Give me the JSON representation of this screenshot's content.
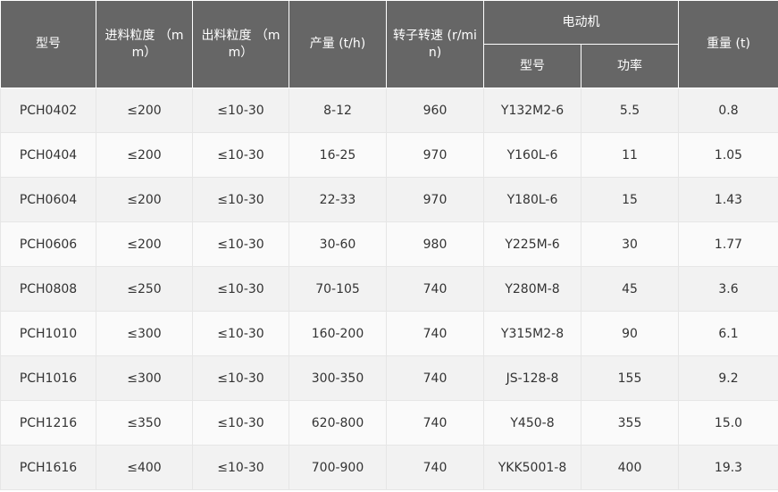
{
  "headers": {
    "model": "型号",
    "feed_size": "进料粒度 （mm）",
    "discharge_size": "出料粒度 （mm）",
    "capacity": "产量 (t/h)",
    "rotor_speed": "转子转速 (r/min)",
    "motor": "电动机",
    "motor_model": "型号",
    "motor_power": "功率",
    "weight": "重量 (t)"
  },
  "rows": [
    [
      "PCH0402",
      "≤200",
      "≤10-30",
      "8-12",
      "960",
      "Y132M2-6",
      "5.5",
      "0.8"
    ],
    [
      "PCH0404",
      "≤200",
      "≤10-30",
      "16-25",
      "970",
      "Y160L-6",
      "11",
      "1.05"
    ],
    [
      "PCH0604",
      "≤200",
      "≤10-30",
      "22-33",
      "970",
      "Y180L-6",
      "15",
      "1.43"
    ],
    [
      "PCH0606",
      "≤200",
      "≤10-30",
      "30-60",
      "980",
      "Y225M-6",
      "30",
      "1.77"
    ],
    [
      "PCH0808",
      "≤250",
      "≤10-30",
      "70-105",
      "740",
      "Y280M-8",
      "45",
      "3.6"
    ],
    [
      "PCH1010",
      "≤300",
      "≤10-30",
      "160-200",
      "740",
      "Y315M2-8",
      "90",
      "6.1"
    ],
    [
      "PCH1016",
      "≤300",
      "≤10-30",
      "300-350",
      "740",
      "JS-128-8",
      "155",
      "9.2"
    ],
    [
      "PCH1216",
      "≤350",
      "≤10-30",
      "620-800",
      "740",
      "Y450-8",
      "355",
      "15.0"
    ],
    [
      "PCH1616",
      "≤400",
      "≤10-30",
      "700-900",
      "740",
      "YKK5001-8",
      "400",
      "19.3"
    ]
  ]
}
